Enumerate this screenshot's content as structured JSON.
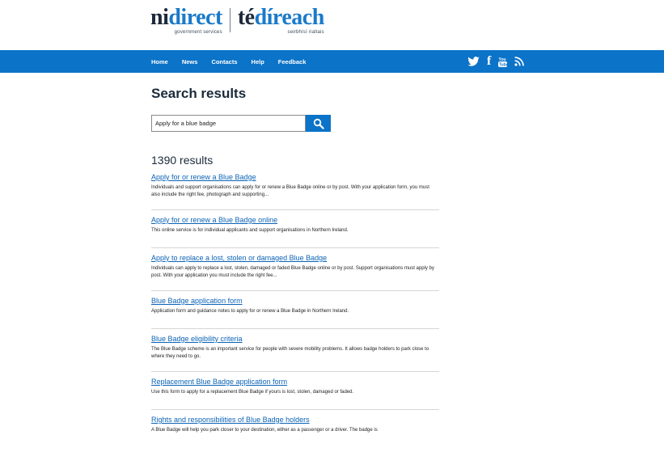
{
  "logo": {
    "left_dark": "ni",
    "left_blue": "direct",
    "left_sub": "government services",
    "right_dark": "té",
    "right_blue": "díreach",
    "right_sub": "seirbhísí rialtais"
  },
  "nav": {
    "items": [
      "Home",
      "News",
      "Contacts",
      "Help",
      "Feedback"
    ],
    "social": [
      "twitter-icon",
      "facebook-icon",
      "youtube-icon",
      "rss-icon"
    ]
  },
  "colors": {
    "brand_blue": "#0b73c8",
    "link_blue": "#0b63b6"
  },
  "page_title": "Search results",
  "search": {
    "value": "Apply for a blue badge"
  },
  "result_count": "1390 results",
  "results": [
    {
      "title": "Apply for or renew a Blue Badge",
      "desc": "Individuals and support organisations can apply for or renew a Blue Badge online or by post. With your application form, you must also include the right fee, photograph and supporting..."
    },
    {
      "title": "Apply for or renew a Blue Badge online",
      "desc": "This online service is for individual applicants and support organisations in Northern Ireland."
    },
    {
      "title": "Apply to replace a lost, stolen or damaged Blue Badge",
      "desc": "Individuals can apply to replace a lost, stolen, damaged or faded Blue Badge online or by post. Support organisations must apply by post. With your application you must include the right fee..."
    },
    {
      "title": "Blue Badge application form",
      "desc": "Application form and guidance notes to apply for or renew a Blue Badge in Northern Ireland."
    },
    {
      "title": "Blue Badge eligibility criteria",
      "desc": "The Blue Badge scheme is an important service for people with severe mobility problems. It allows badge holders to park close to where they need to go."
    },
    {
      "title": "Replacement Blue Badge application form",
      "desc": "Use this form to apply for a replacement Blue Badge if yours is lost, stolen, damaged or faded."
    },
    {
      "title": "Rights and responsibilities of Blue Badge holders",
      "desc": "A Blue Badge will help you park closer to your destination, either as a passenger or a driver. The badge is"
    }
  ]
}
